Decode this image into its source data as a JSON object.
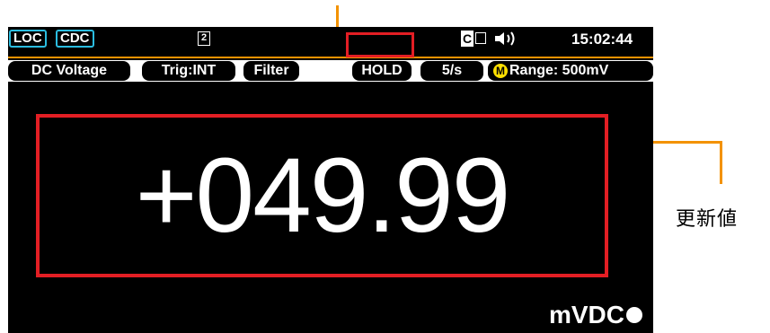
{
  "status_bar": {
    "loc_badge": "LOC",
    "mode_badge": "CDC",
    "slot_icon_label": "2",
    "ce_label": "C",
    "speaker_icon": "speaker-icon",
    "clock": "15:02:44"
  },
  "tabs": {
    "function": "DC Voltage",
    "trigger": "Trig:INT",
    "filter": "Filter",
    "hold": "HOLD",
    "rate": "5/s",
    "auto_badge": "M",
    "range": "Range: 500mV"
  },
  "reading": {
    "value": "+049.99",
    "unit": "mVDC"
  },
  "annotation": {
    "caption": "更新値"
  },
  "colors": {
    "badge_border": "#2bbde0",
    "highlight": "#e31e24",
    "callout": "#f39200",
    "auto_badge": "#ffe000"
  }
}
